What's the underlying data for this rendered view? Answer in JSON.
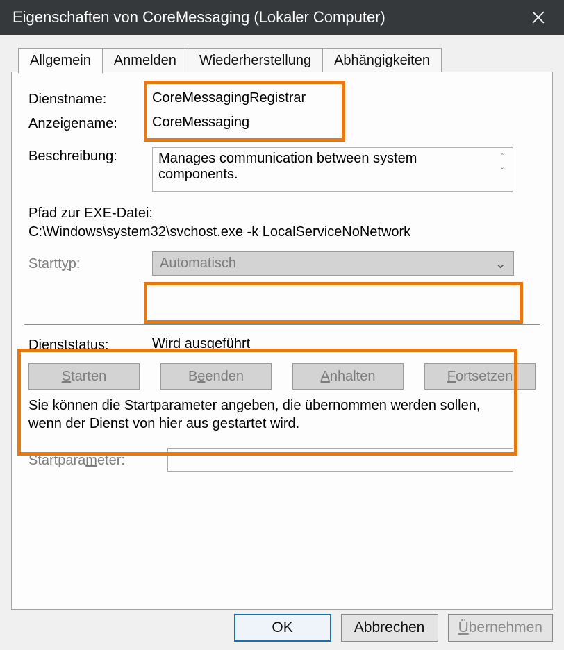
{
  "titlebar": {
    "title": "Eigenschaften von CoreMessaging (Lokaler Computer)"
  },
  "tabs": {
    "t0": "Allgemein",
    "t1": "Anmelden",
    "t2": "Wiederherstellung",
    "t3": "Abhängigkeiten"
  },
  "general": {
    "serviceNameLabel": "Dienstname:",
    "serviceNameValue": "CoreMessagingRegistrar",
    "displayNameLabel": "Anzeigename:",
    "displayNameValue": "CoreMessaging",
    "descriptionLabel": "Beschreibung:",
    "descriptionValue": "Manages communication between system components.",
    "exePathLabel": "Pfad zur EXE-Datei:",
    "exePathValue": "C:\\Windows\\system32\\svchost.exe -k LocalServiceNoNetwork",
    "startTypeLabel": "Starttyp:",
    "startTypeValue": "Automatisch",
    "statusLabel": "Dienststatus:",
    "statusValue": "Wird ausgeführt",
    "buttons": {
      "start": "Starten",
      "stop": "Beenden",
      "pause": "Anhalten",
      "resume": "Fortsetzen"
    },
    "note": "Sie können die Startparameter angeben, die übernommen werden sollen, wenn der Dienst von hier aus gestartet wird.",
    "startParamsLabel": "Startparameter:",
    "startParamsValue": ""
  },
  "footer": {
    "ok": "OK",
    "cancel": "Abbrechen",
    "apply": "Übernehmen"
  },
  "colors": {
    "highlight": "#e67913"
  }
}
